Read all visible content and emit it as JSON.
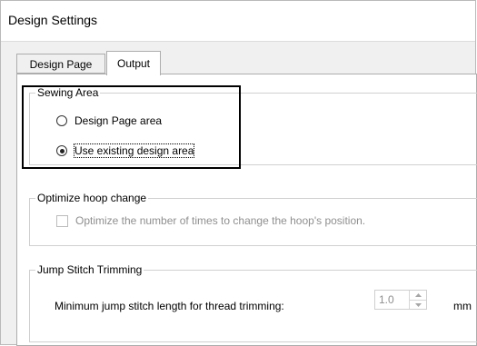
{
  "window": {
    "title": "Design Settings"
  },
  "tabs": [
    {
      "label": "Design Page",
      "active": false
    },
    {
      "label": "Output",
      "active": true
    }
  ],
  "sewing_area": {
    "legend": "Sewing Area",
    "options": [
      {
        "label": "Design Page area",
        "selected": false
      },
      {
        "label": "Use existing design area",
        "selected": true
      }
    ]
  },
  "optimize": {
    "legend": "Optimize hoop change",
    "checkbox_label": "Optimize the number of times to change the hoop's position.",
    "checked": false,
    "enabled": false
  },
  "jump": {
    "legend": "Jump Stitch Trimming",
    "label": "Minimum jump stitch length for thread trimming:",
    "value": "1.0",
    "unit": "mm",
    "enabled": false
  },
  "icons": {
    "spin_up": "spin-up-icon",
    "spin_down": "spin-down-icon"
  }
}
